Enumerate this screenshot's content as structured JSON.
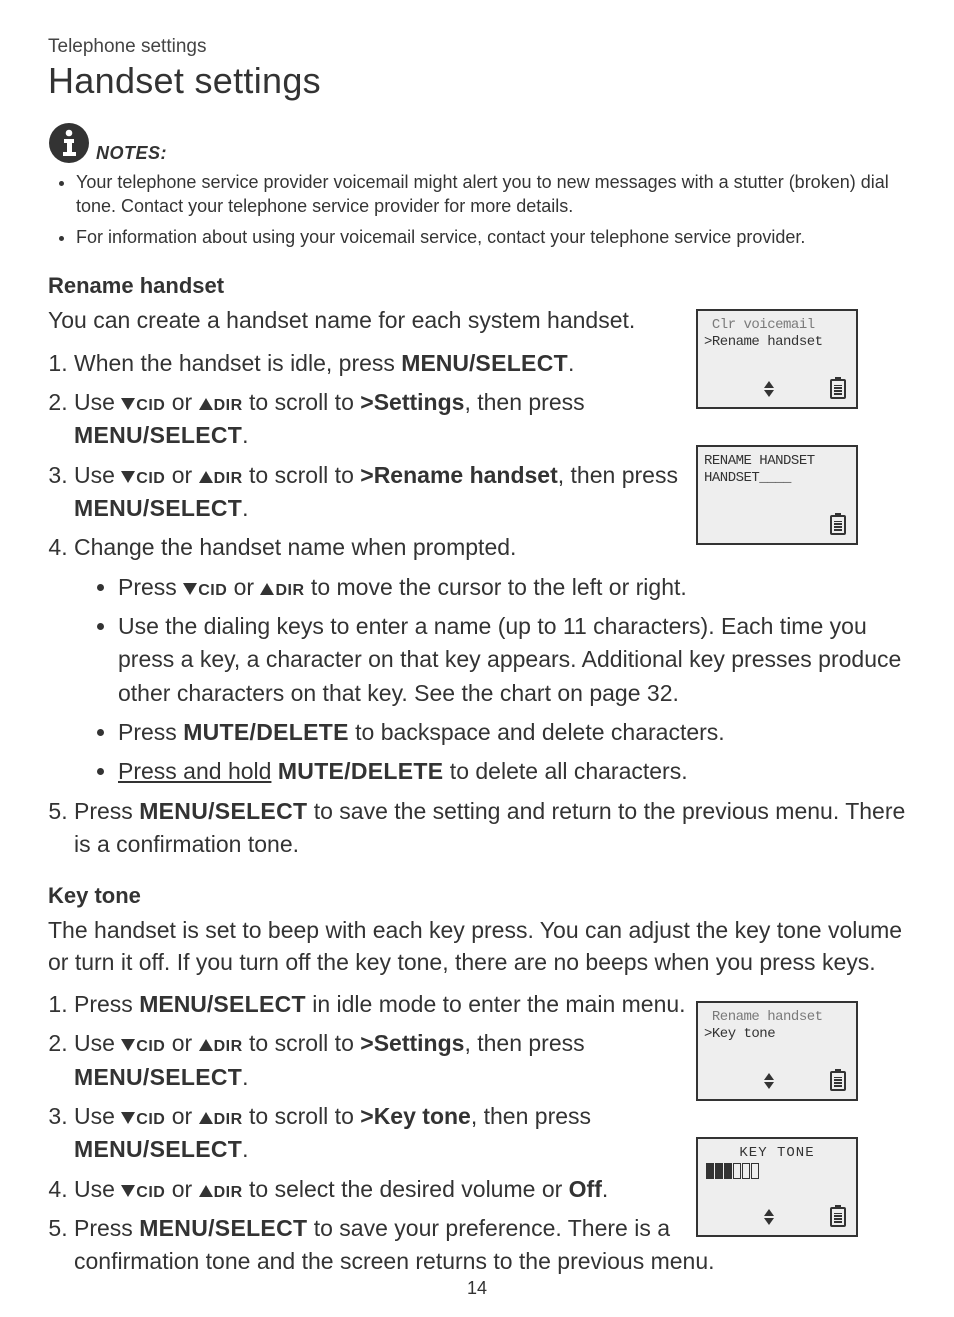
{
  "header": {
    "section": "Telephone settings",
    "title": "Handset settings"
  },
  "notes": {
    "label": "NOTES:",
    "items": [
      "Your telephone service provider voicemail might alert you to new messages with a stutter (broken) dial tone. Contact your telephone service provider for more details.",
      "For information about using your voicemail service, contact your telephone service provider."
    ]
  },
  "keys": {
    "cid": "CID",
    "dir": "DIR",
    "menu_select": "MENU/SELECT",
    "menu": "MENU/",
    "select_sc": "SELECT",
    "mute_delete": "MUTE/DELETE",
    "off": "Off"
  },
  "rename": {
    "heading": "Rename handset",
    "intro": "You can create a handset name for each system handset.",
    "step1_a": "When the handset is idle, press ",
    "step2_a": "Use ",
    "step2_b": " or ",
    "step2_c": " to scroll to ",
    "step2_target": ">Settings",
    "step2_d": ", then press ",
    "step3_target": ">Rename handset",
    "step4": "Change the handset name when prompted.",
    "sub_a_a": "Press ",
    "sub_a_b": " or ",
    "sub_a_c": " to move the cursor to the left or right.",
    "sub_b": "Use the dialing keys to enter a name (up to 11 characters). Each time you press a key, a character on that key appears. Additional key presses produce other characters on that key. See the chart on page 32.",
    "sub_c_a": "Press ",
    "sub_c_b": " to backspace and delete characters.",
    "sub_d_a": "Press and hold",
    "sub_d_b": " to delete all characters.",
    "step5_a": "Press ",
    "step5_b": " to save the setting and return to the previous menu. There is a confirmation tone."
  },
  "keytone": {
    "heading": "Key tone",
    "intro": "The handset is set to beep with each key press. You can adjust the key tone volume or turn it off. If you turn off the key tone, there are no beeps when you press keys.",
    "step1_a": "Press ",
    "step1_b": " in idle mode to enter the main menu.",
    "step3_target": ">Key tone",
    "step4_a": "Use ",
    "step4_b": " or ",
    "step4_c": " to select the desired volume or ",
    "step5_a": "Press ",
    "step5_b": " to save your preference. There is a confirmation tone and the screen returns to the previous menu."
  },
  "lcd": {
    "s1_l1": " Clr voicemail",
    "s1_l2": ">Rename handset",
    "s2_l1": "RENAME HANDSET",
    "s2_l2": "HANDSET____",
    "s3_l1": " Rename handset",
    "s3_l2": ">Key tone",
    "s4_l1": "KEY TONE"
  },
  "page_number": "14"
}
